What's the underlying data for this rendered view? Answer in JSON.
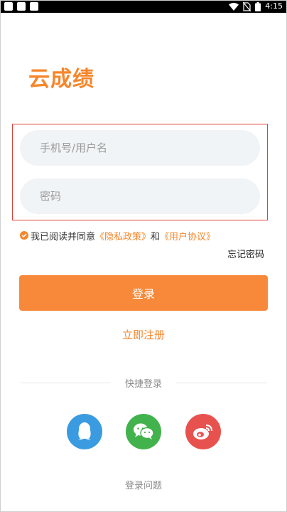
{
  "status_bar": {
    "time": "4:15",
    "icons": [
      "notification-square-icon",
      "notification-square-icon",
      "notification-square-icon",
      "wifi-icon",
      "no-sim-icon",
      "battery-icon"
    ]
  },
  "app": {
    "title": "云成绩"
  },
  "form": {
    "username_placeholder": "手机号/用户名",
    "password_placeholder": "密码"
  },
  "agreement": {
    "prefix": "我已阅读并同意",
    "privacy_link": "《隐私政策》",
    "and": "和",
    "user_agreement_link": "《用户协议》"
  },
  "forgot_password": "忘记密码",
  "login_button": "登录",
  "register_link": "立即注册",
  "quick_login": {
    "label": "快捷登录",
    "providers": [
      {
        "icon": "qq-icon",
        "color": "#3A9BE0"
      },
      {
        "icon": "wechat-icon",
        "color": "#42B24C"
      },
      {
        "icon": "weibo-icon",
        "color": "#E8524E"
      }
    ]
  },
  "help_link": "登录问题",
  "colors": {
    "accent": "#F6862B",
    "button": "#F8893A",
    "outline": "#E0423A"
  }
}
